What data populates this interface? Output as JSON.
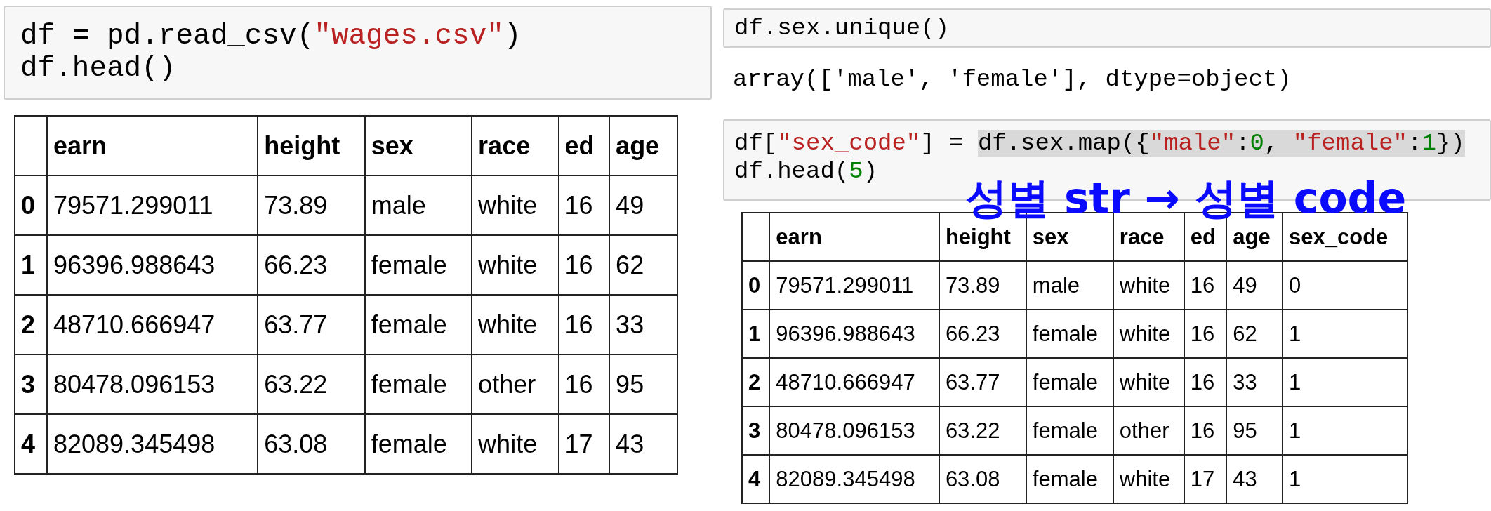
{
  "left": {
    "code_cell": {
      "lines": [
        [
          {
            "text": "df = pd.read_csv(",
            "kind": "plain",
            "highlighted": false
          },
          {
            "text": "\"wages.csv\"",
            "kind": "string",
            "highlighted": false
          },
          {
            "text": ")",
            "kind": "plain",
            "highlighted": false
          }
        ],
        [
          {
            "text": "df.head()",
            "kind": "plain",
            "highlighted": false
          }
        ]
      ]
    },
    "table": {
      "columns": [
        "earn",
        "height",
        "sex",
        "race",
        "ed",
        "age"
      ],
      "rows": [
        {
          "index": "0",
          "cells": [
            "79571.299011",
            "73.89",
            "male",
            "white",
            "16",
            "49"
          ]
        },
        {
          "index": "1",
          "cells": [
            "96396.988643",
            "66.23",
            "female",
            "white",
            "16",
            "62"
          ]
        },
        {
          "index": "2",
          "cells": [
            "48710.666947",
            "63.77",
            "female",
            "white",
            "16",
            "33"
          ]
        },
        {
          "index": "3",
          "cells": [
            "80478.096153",
            "63.22",
            "female",
            "other",
            "16",
            "95"
          ]
        },
        {
          "index": "4",
          "cells": [
            "82089.345498",
            "63.08",
            "female",
            "white",
            "17",
            "43"
          ]
        }
      ]
    }
  },
  "right": {
    "code_cell_1": {
      "lines": [
        [
          {
            "text": "df.sex.unique()",
            "kind": "plain",
            "highlighted": false
          }
        ]
      ]
    },
    "output": "array(['male', 'female'], dtype=object)",
    "code_cell_2": {
      "lines": [
        [
          {
            "text": "df[",
            "kind": "plain",
            "highlighted": false
          },
          {
            "text": "\"sex_code\"",
            "kind": "string",
            "highlighted": false
          },
          {
            "text": "] = ",
            "kind": "plain",
            "highlighted": false
          },
          {
            "text": "df.sex.map({",
            "kind": "plain",
            "highlighted": true
          },
          {
            "text": "\"male\"",
            "kind": "string",
            "highlighted": true
          },
          {
            "text": ":",
            "kind": "plain",
            "highlighted": true
          },
          {
            "text": "0",
            "kind": "number",
            "highlighted": true
          },
          {
            "text": ", ",
            "kind": "plain",
            "highlighted": true
          },
          {
            "text": "\"female\"",
            "kind": "string",
            "highlighted": true
          },
          {
            "text": ":",
            "kind": "plain",
            "highlighted": true
          },
          {
            "text": "1",
            "kind": "number",
            "highlighted": true
          },
          {
            "text": "})",
            "kind": "plain",
            "highlighted": true
          }
        ],
        [
          {
            "text": "df.head(",
            "kind": "plain",
            "highlighted": false
          },
          {
            "text": "5",
            "kind": "number",
            "highlighted": false
          },
          {
            "text": ")",
            "kind": "plain",
            "highlighted": false
          }
        ]
      ]
    },
    "annotation": "성별 str → 성별 code",
    "table": {
      "columns": [
        "earn",
        "height",
        "sex",
        "race",
        "ed",
        "age",
        "sex_code"
      ],
      "rows": [
        {
          "index": "0",
          "cells": [
            "79571.299011",
            "73.89",
            "male",
            "white",
            "16",
            "49",
            "0"
          ]
        },
        {
          "index": "1",
          "cells": [
            "96396.988643",
            "66.23",
            "female",
            "white",
            "16",
            "62",
            "1"
          ]
        },
        {
          "index": "2",
          "cells": [
            "48710.666947",
            "63.77",
            "female",
            "white",
            "16",
            "33",
            "1"
          ]
        },
        {
          "index": "3",
          "cells": [
            "80478.096153",
            "63.22",
            "female",
            "other",
            "16",
            "95",
            "1"
          ]
        },
        {
          "index": "4",
          "cells": [
            "82089.345498",
            "63.08",
            "female",
            "white",
            "17",
            "43",
            "1"
          ]
        }
      ]
    }
  }
}
